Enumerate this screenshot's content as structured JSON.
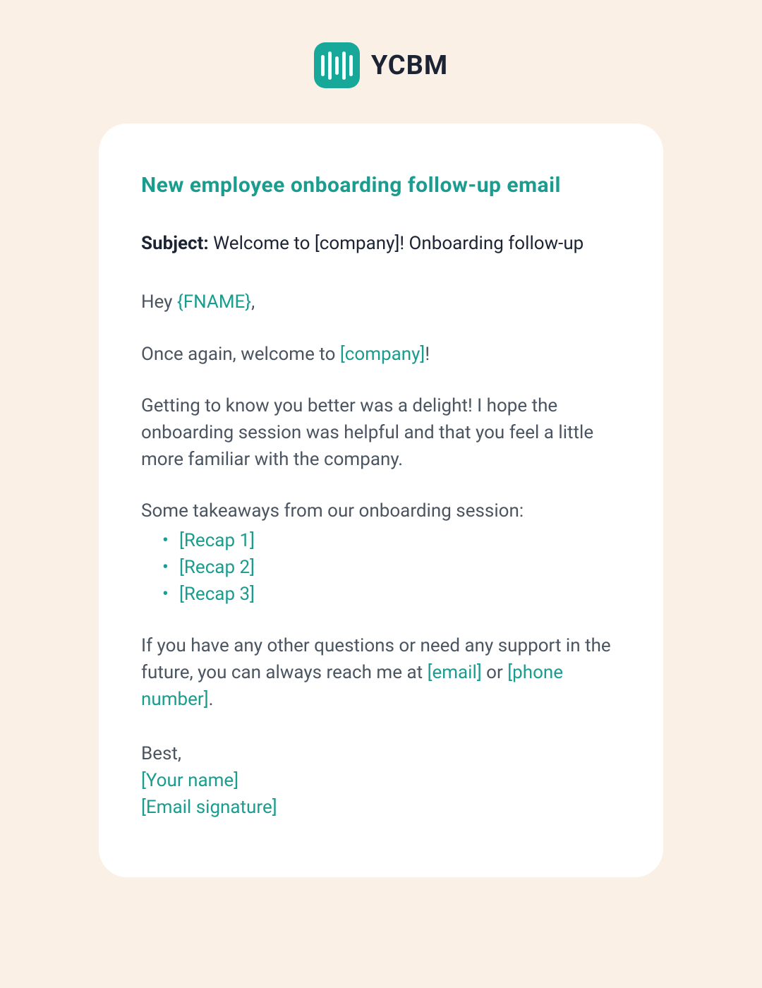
{
  "brand": {
    "name": "YCBM"
  },
  "card": {
    "title": "New employee onboarding follow-up email",
    "subject_label": "Subject:",
    "subject_value": " Welcome to [company]! Onboarding follow-up",
    "greeting_pre": "Hey ",
    "greeting_placeholder": "{FNAME}",
    "greeting_post": ",",
    "welcome_pre": "Once again, welcome to ",
    "welcome_placeholder": "[company]",
    "welcome_post": "!",
    "para_delight": "Getting to know you better was a delight! I hope the onboarding session was helpful and that you feel a little more familiar with the company.",
    "takeaways_intro": "Some takeaways from our onboarding session:",
    "takeaways": [
      "[Recap 1]",
      "[Recap 2]",
      "[Recap 3]"
    ],
    "support_pre": "If you have any other questions or need any support in the future, you can always reach me at ",
    "support_email": "[email]",
    "support_mid": " or ",
    "support_phone": "[phone number]",
    "support_post": ".",
    "signoff_best": "Best,",
    "signoff_name": "[Your name]",
    "signoff_sig": "[Email signature]"
  }
}
